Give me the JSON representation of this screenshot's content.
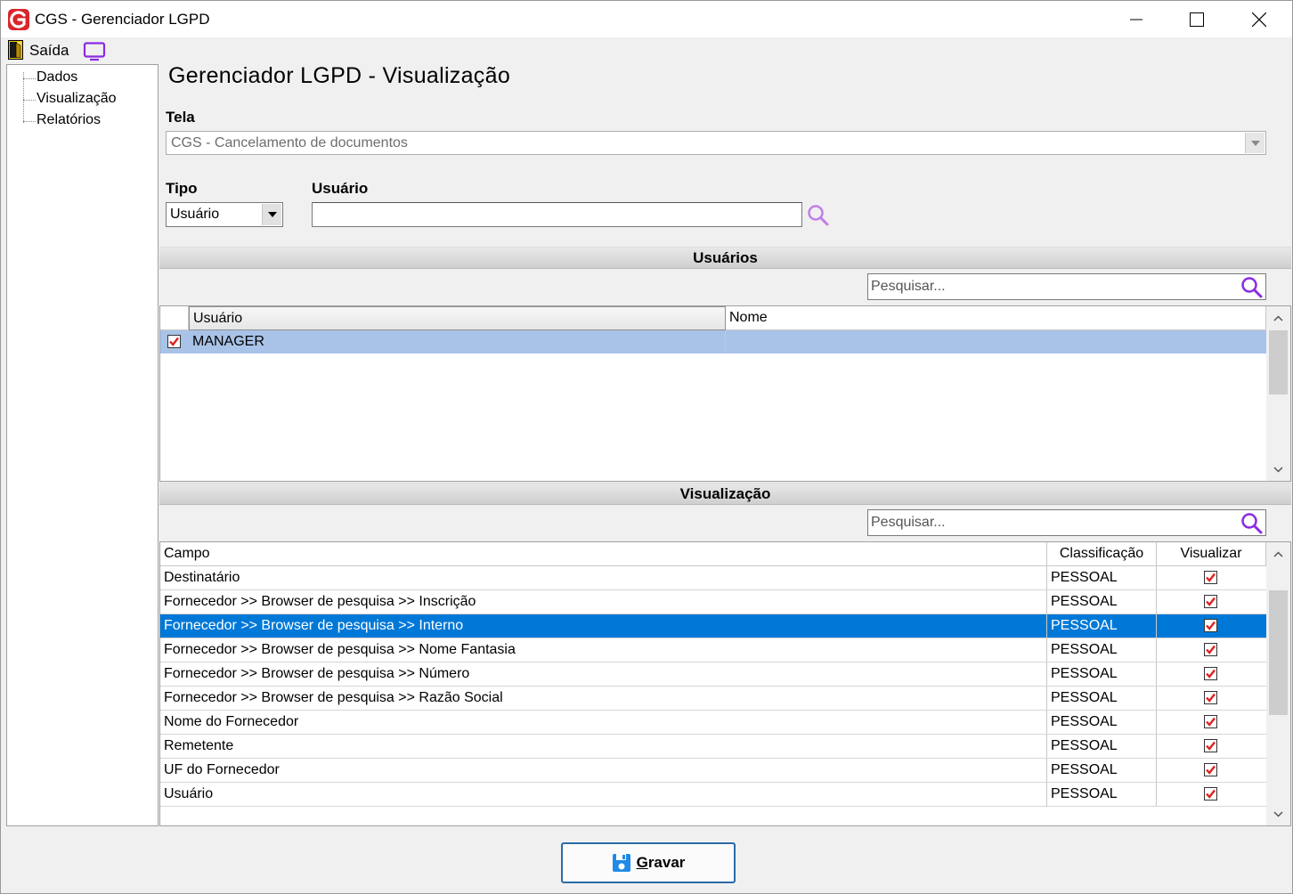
{
  "window": {
    "title": "CGS - Gerenciador LGPD"
  },
  "menu": {
    "exit_label": "Saída"
  },
  "tree": {
    "items": [
      {
        "label": "Dados"
      },
      {
        "label": "Visualização"
      },
      {
        "label": "Relatórios"
      }
    ]
  },
  "main": {
    "title": "Gerenciador LGPD - Visualização",
    "tela_label": "Tela",
    "tela_value": "CGS - Cancelamento de documentos",
    "tipo_label": "Tipo",
    "tipo_value": "Usuário",
    "usuario_label": "Usuário",
    "usuario_value": ""
  },
  "usuarios_section": {
    "title": "Usuários",
    "search_placeholder": "Pesquisar...",
    "columns": [
      "Usuário",
      "Nome"
    ],
    "rows": [
      {
        "checked": true,
        "usuario": "MANAGER",
        "nome": ""
      }
    ]
  },
  "visualizacao_section": {
    "title": "Visualização",
    "search_placeholder": "Pesquisar...",
    "columns": [
      "Campo",
      "Classificação",
      "Visualizar"
    ],
    "rows": [
      {
        "campo": "Destinatário",
        "classificacao": "PESSOAL",
        "visualizar": true
      },
      {
        "campo": "Fornecedor >> Browser de pesquisa >> Inscrição",
        "classificacao": "PESSOAL",
        "visualizar": true
      },
      {
        "campo": "Fornecedor >> Browser de pesquisa >> Interno",
        "classificacao": "PESSOAL",
        "visualizar": true
      },
      {
        "campo": "Fornecedor >> Browser de pesquisa >> Nome Fantasia",
        "classificacao": "PESSOAL",
        "visualizar": true
      },
      {
        "campo": "Fornecedor >> Browser de pesquisa >> Número",
        "classificacao": "PESSOAL",
        "visualizar": true
      },
      {
        "campo": "Fornecedor >> Browser de pesquisa >> Razão Social",
        "classificacao": "PESSOAL",
        "visualizar": true
      },
      {
        "campo": "Nome do Fornecedor",
        "classificacao": "PESSOAL",
        "visualizar": true
      },
      {
        "campo": "Remetente",
        "classificacao": "PESSOAL",
        "visualizar": true
      },
      {
        "campo": "UF do Fornecedor",
        "classificacao": "PESSOAL",
        "visualizar": true
      },
      {
        "campo": "Usuário",
        "classificacao": "PESSOAL",
        "visualizar": true
      }
    ],
    "selected_row": 2
  },
  "footer": {
    "save_label_underlined": "G",
    "save_label_rest": "ravar"
  },
  "icons": {
    "app": "cgs-logo-icon",
    "exit": "exit-door-icon",
    "monitor": "monitor-icon",
    "search": "magnifier-icon",
    "save": "floppy-disk-icon",
    "check": "checkbox-checked-icon"
  },
  "colors": {
    "accent_purple": "#8a2be2",
    "selection_blue": "#0078d7",
    "user_row_highlight": "#a9c3e8",
    "check_red": "#e02020",
    "logo_red": "#d9262c"
  }
}
